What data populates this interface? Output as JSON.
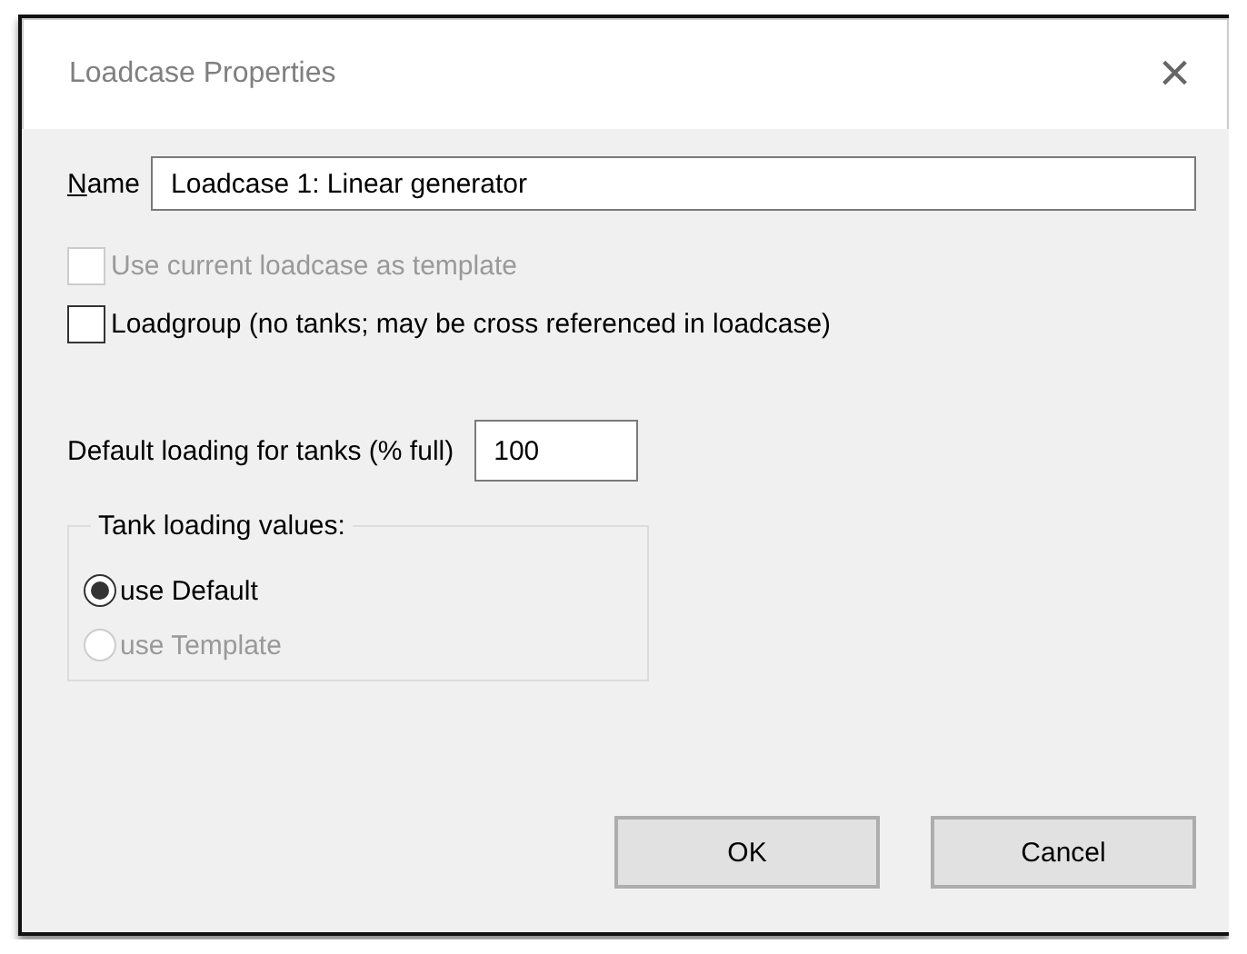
{
  "window": {
    "title": "Loadcase Properties",
    "close": "×"
  },
  "name_field": {
    "label": "Name",
    "value": "Loadcase 1: Linear generator"
  },
  "checkboxes": [
    {
      "label": "Use current loadcase as template",
      "checked": false,
      "disabled": true
    },
    {
      "label": "Loadgroup (no tanks; may be cross referenced in loadcase)",
      "checked": false,
      "disabled": false
    }
  ],
  "default_loading": {
    "label": "Default loading for tanks (% full)",
    "value": "100"
  },
  "tank_loading": {
    "title": "Tank loading values:",
    "options": [
      {
        "label": "use Default",
        "selected": true,
        "disabled": false
      },
      {
        "label": "use Template",
        "selected": false,
        "disabled": true
      }
    ]
  },
  "buttons": [
    "OK",
    "Cancel"
  ]
}
